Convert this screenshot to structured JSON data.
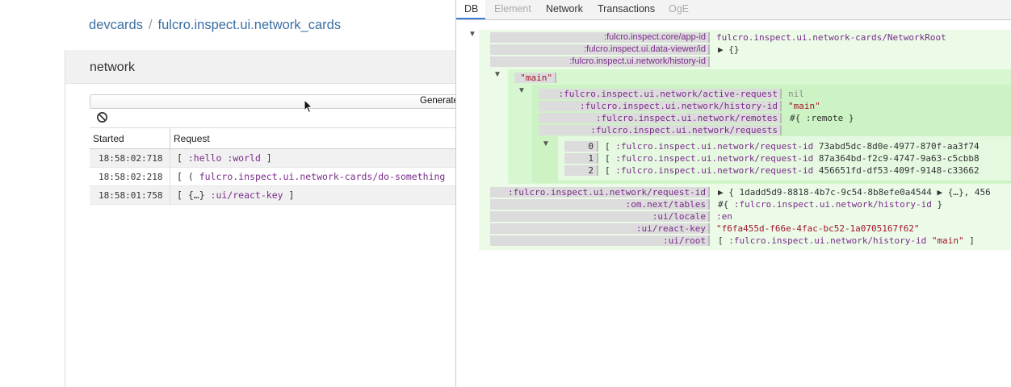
{
  "devcards": {
    "breadcrumb_root": "devcards",
    "breadcrumb_sep": "/",
    "breadcrumb_ns": "fulcro.inspect.ui.network_cards",
    "card_title": "network",
    "generate_label": "Generate",
    "table": {
      "headers": [
        "Started",
        "Request"
      ],
      "rows": [
        {
          "started": "18:58:02:718",
          "parts": [
            [
              "pl",
              "[ "
            ],
            [
              "kw",
              ":hello :world"
            ],
            [
              "pl",
              " ]"
            ]
          ]
        },
        {
          "started": "18:58:02:218",
          "parts": [
            [
              "pl",
              "[ ( "
            ],
            [
              "kw",
              "fulcro.inspect.ui.network-cards/do-something"
            ]
          ]
        },
        {
          "started": "18:58:01:758",
          "parts": [
            [
              "pl",
              "[ {…} "
            ],
            [
              "kw",
              ":ui/react-key"
            ],
            [
              "pl",
              " ]"
            ]
          ]
        }
      ]
    }
  },
  "inspector": {
    "tabs": [
      {
        "label": "DB",
        "state": "active"
      },
      {
        "label": "Element",
        "state": "disabled"
      },
      {
        "label": "Network",
        "state": "normal"
      },
      {
        "label": "Transactions",
        "state": "normal"
      },
      {
        "label": "OgE",
        "state": "disabled"
      }
    ],
    "top_keys": [
      {
        "key": ":fulcro.inspect.core/app-id",
        "value": "fulcro.inspect.ui.network-cards/NetworkRoot",
        "vclass": "kw"
      },
      {
        "key": ":fulcro.inspect.ui.data-viewer/id",
        "value": "▶ {}",
        "vclass": "pl"
      },
      {
        "key": ":fulcro.inspect.ui.network/history-id",
        "value": "",
        "vclass": "pl"
      }
    ],
    "history_key": "\"main\"",
    "main_entries": [
      {
        "key": ":fulcro.inspect.ui.network/active-request",
        "value": "nil",
        "vclass": "nil"
      },
      {
        "key": ":fulcro.inspect.ui.network/history-id",
        "value": "\"main\"",
        "vclass": "str"
      },
      {
        "key": ":fulcro.inspect.ui.network/remotes",
        "value": "#{ :remote }",
        "vclass": "pl"
      },
      {
        "key": ":fulcro.inspect.ui.network/requests",
        "value": "",
        "vclass": "pl"
      }
    ],
    "requests": [
      {
        "index": "0",
        "key": ":fulcro.inspect.ui.network/request-id",
        "id": "73abd5dc-8d0e-4977-870f-aa3f74"
      },
      {
        "index": "1",
        "key": ":fulcro.inspect.ui.network/request-id",
        "id": "87a364bd-f2c9-4747-9a63-c5cbb8"
      },
      {
        "index": "2",
        "key": ":fulcro.inspect.ui.network/request-id",
        "id": "456651fd-df53-409f-9148-c33662"
      }
    ],
    "bottom_keys": [
      {
        "key": ":fulcro.inspect.ui.network/request-id",
        "value": "▶ { 1dadd5d9-8818-4b7c-9c54-8b8efe0a4544  ▶ {…}, 456",
        "vclass": "pl"
      },
      {
        "key": ":om.next/tables",
        "value": "#{ :fulcro.inspect.ui.network/history-id }",
        "vclass": "pl"
      },
      {
        "key": ":ui/locale",
        "value": ":en",
        "vclass": "kw"
      },
      {
        "key": ":ui/react-key",
        "value": "\"f6fa455d-f66e-4fac-bc52-1a0705167f62\"",
        "vclass": "str"
      },
      {
        "key": ":ui/root",
        "value": "[ :fulcro.inspect.ui.network/history-id \"main\" ]",
        "vclass": "pl"
      }
    ],
    "colors": {
      "keyword": "#7a2b8a",
      "string": "#a1162a",
      "db_bg": "#ebfbe8",
      "accent": "#3f7ed8"
    }
  }
}
